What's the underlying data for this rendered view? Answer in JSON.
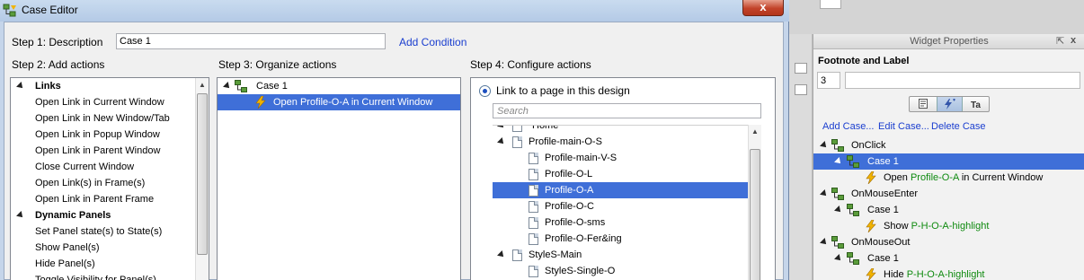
{
  "dialog": {
    "title": "Case Editor",
    "close": "x",
    "step1_label": "Step 1: Description",
    "description_value": "Case 1",
    "add_condition": "Add Condition",
    "step2_label": "Step 2: Add actions",
    "step3_label": "Step 3: Organize actions",
    "step4_label": "Step 4: Configure actions"
  },
  "actions": {
    "links_group": "Links",
    "items_links": [
      "Open Link in Current Window",
      "Open Link in New Window/Tab",
      "Open Link in Popup Window",
      "Open Link in Parent Window",
      "Close Current Window",
      "Open Link(s) in Frame(s)",
      "Open Link in Parent Frame"
    ],
    "panels_group": "Dynamic Panels",
    "items_panels": [
      "Set Panel state(s) to State(s)",
      "Show Panel(s)",
      "Hide Panel(s)",
      "Toggle Visibility for Panel(s)"
    ]
  },
  "organize": {
    "case": "Case 1",
    "action": "Open Profile-O-A in Current Window"
  },
  "configure": {
    "radio_label": "Link to a page in this design",
    "search_placeholder": "Search",
    "home": "Home",
    "pages": [
      {
        "label": "Profile-main-O-S",
        "level": 1,
        "expander": true,
        "selected": false
      },
      {
        "label": "Profile-main-V-S",
        "level": 2,
        "expander": false,
        "selected": false
      },
      {
        "label": "Profile-O-L",
        "level": 2,
        "expander": false,
        "selected": false
      },
      {
        "label": "Profile-O-A",
        "level": 2,
        "expander": false,
        "selected": true
      },
      {
        "label": "Profile-O-C",
        "level": 2,
        "expander": false,
        "selected": false
      },
      {
        "label": "Profile-O-sms",
        "level": 2,
        "expander": false,
        "selected": false
      },
      {
        "label": "Profile-O-Fer&ing",
        "level": 2,
        "expander": false,
        "selected": false
      },
      {
        "label": "StyleS-Main",
        "level": 1,
        "expander": true,
        "selected": false
      },
      {
        "label": "StyleS-Single-O",
        "level": 2,
        "expander": false,
        "selected": false
      }
    ]
  },
  "widget_properties": {
    "title": "Widget Properties",
    "pin": "⇱",
    "close": "x",
    "section": "Footnote and Label",
    "footnote_value": "3",
    "label_value": "",
    "add_case": "Add Case...",
    "edit_case": "Edit Case...",
    "delete_case": "Delete Case",
    "events": [
      {
        "name": "OnClick",
        "case": "Case 1",
        "case_selected": true,
        "verb": "Open ",
        "target": "Profile-O-A",
        "rest": " in Current Window"
      },
      {
        "name": "OnMouseEnter",
        "case": "Case 1",
        "case_selected": false,
        "verb": "Show ",
        "target": "P-H-O-A-highlight",
        "rest": ""
      },
      {
        "name": "OnMouseOut",
        "case": "Case 1",
        "case_selected": false,
        "verb": "Hide ",
        "target": "P-H-O-A-highlight",
        "rest": ""
      }
    ]
  },
  "colors": {
    "selection": "#3f6fd8",
    "link": "#1a3ecf",
    "target_green": "#0f8a0f",
    "close_red": "#c2432a"
  }
}
